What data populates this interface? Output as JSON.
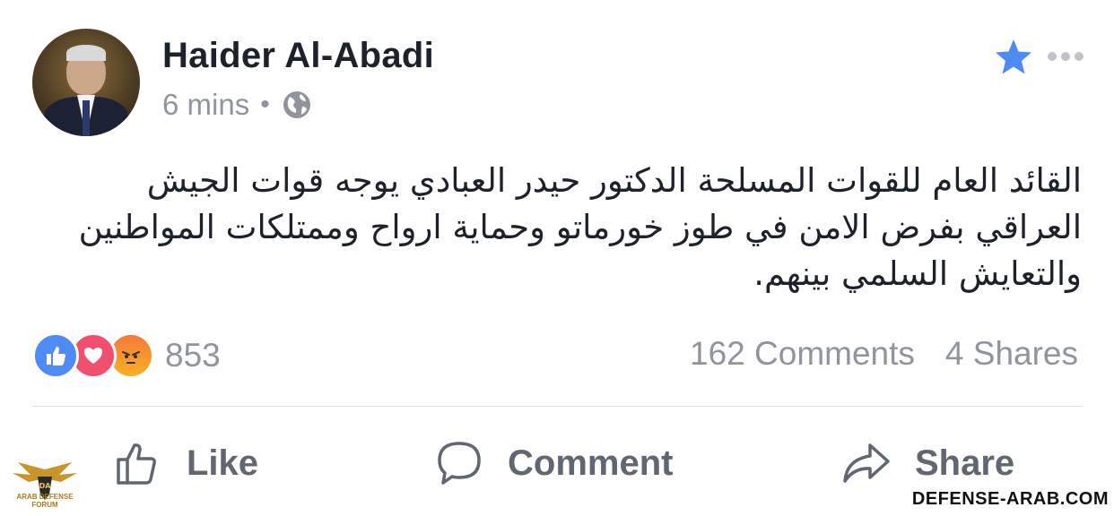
{
  "post": {
    "author": "Haider Al-Abadi",
    "time": "6 mins",
    "separator": "•",
    "text": "القائد العام للقوات المسلحة الدكتور حيدر العبادي يوجه قوات الجيش العراقي بفرض الامن في طوز خورماتو وحماية ارواح وممتلكات المواطنين والتعايش السلمي بينهم."
  },
  "reactions": {
    "count": "853",
    "types": [
      "like-icon",
      "love-icon",
      "angry-icon"
    ]
  },
  "stats": {
    "comments": "162 Comments",
    "shares": "4 Shares"
  },
  "actions": {
    "like": "Like",
    "comment": "Comment",
    "share": "Share"
  },
  "watermark": {
    "logo_text": "ARAB DEFENSE FORUM",
    "url": "DEFENSE-ARAB.COM"
  },
  "colors": {
    "accent": "#4f8bf4",
    "muted": "#90949c",
    "text": "#1d2129"
  }
}
